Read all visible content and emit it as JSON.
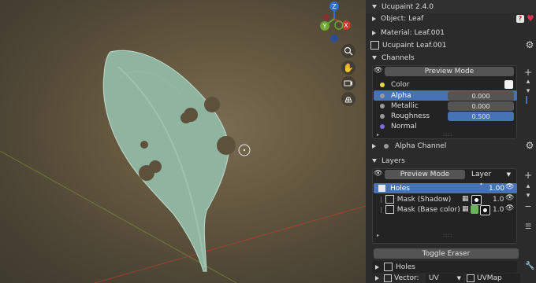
{
  "viewport": {
    "gizmo": {
      "x_label": "X",
      "y_label": "Y",
      "z_label": "Z"
    },
    "tools": [
      {
        "icon": "zoom-icon"
      },
      {
        "icon": "hand-pan-icon"
      },
      {
        "icon": "camera-icon"
      },
      {
        "icon": "grid-icon"
      }
    ],
    "colors": {
      "x_axis": "#c0392b",
      "y_axis": "#6fa531",
      "z_axis": "#2e6fd0"
    }
  },
  "panel": {
    "title": "Ucupaint 2.4.0",
    "object_label": "Object: Leaf",
    "material_label": "Material: Leaf.001",
    "node_label": "Ucupaint Leaf.001",
    "channels": {
      "header": "Channels",
      "preview_mode": "Preview Mode",
      "items": [
        {
          "name": "Color",
          "dot": "#e8d84a",
          "value": ""
        },
        {
          "name": "Alpha",
          "dot": "#9a9a9a",
          "value": "0.000"
        },
        {
          "name": "Metallic",
          "dot": "#9a9a9a",
          "value": "0.000"
        },
        {
          "name": "Roughness",
          "dot": "#9a9a9a",
          "value": "0.500"
        },
        {
          "name": "Normal",
          "dot": "#7b68ee",
          "value": ""
        }
      ],
      "alpha_channel": "Alpha Channel"
    },
    "layers": {
      "header": "Layers",
      "preview_mode": "Preview Mode",
      "layer_dropdown": "Layer",
      "items": [
        {
          "name": "Holes",
          "value": "1.00"
        },
        {
          "name": "Mask (Shadow)",
          "value": "1.0"
        },
        {
          "name": "Mask (Base color)",
          "value": "1.0"
        }
      ],
      "toggle_eraser": "Toggle Eraser",
      "holes_footer": "Holes",
      "vector_label": "Vector:",
      "vector_value": "UV",
      "uvmap_value": "UVMap"
    },
    "accent": "#4772b3"
  }
}
